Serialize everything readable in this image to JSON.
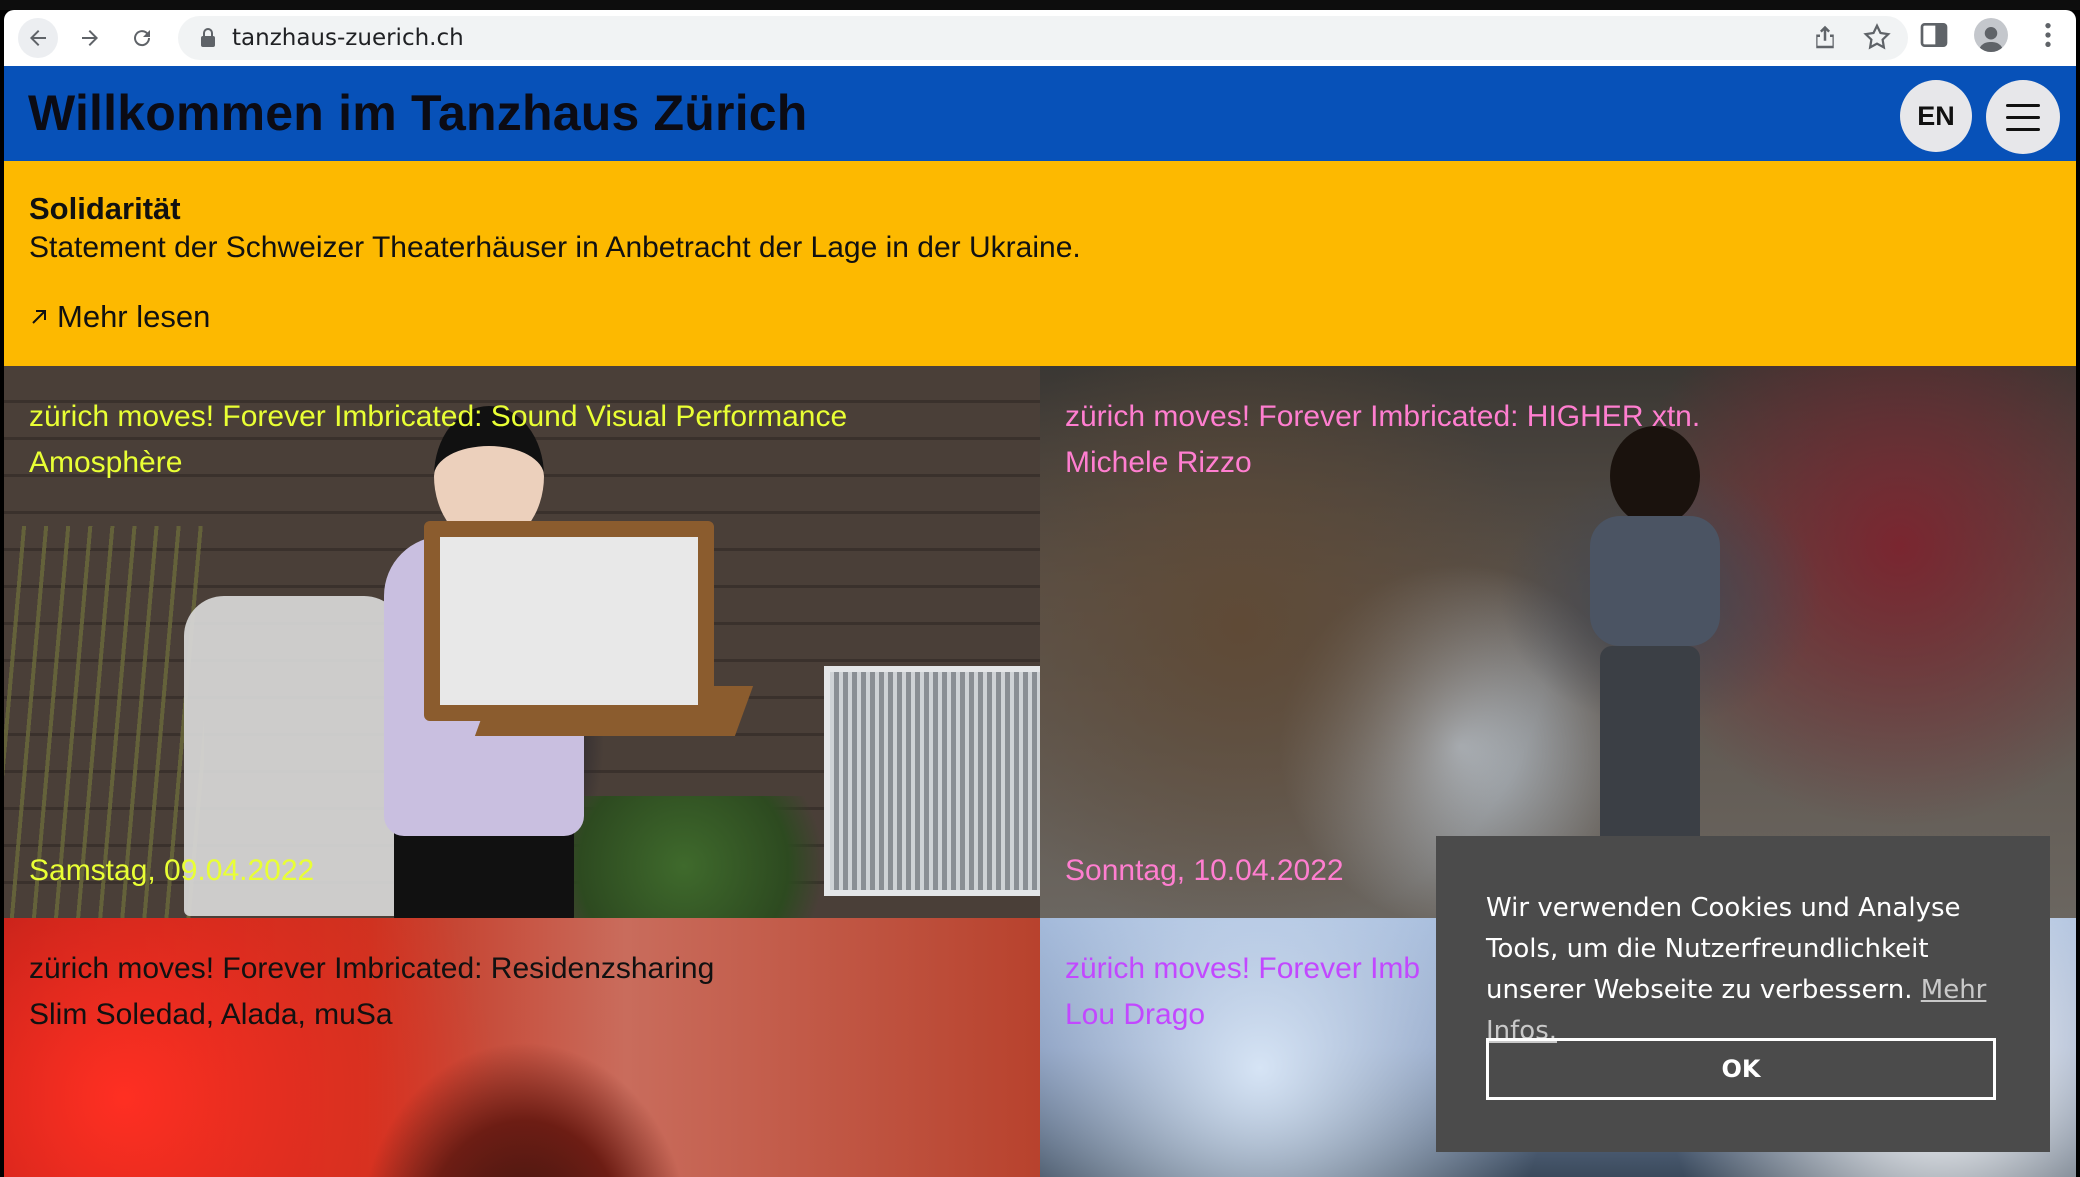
{
  "browser": {
    "url": "tanzhaus-zuerich.ch"
  },
  "header": {
    "title": "Willkommen im Tanzhaus Zürich",
    "lang_button": "EN"
  },
  "banner": {
    "title": "Solidarität",
    "text": "Statement der Schweizer Theaterhäuser in Anbetracht der Lage in der Ukraine.",
    "link": "Mehr lesen"
  },
  "events": [
    {
      "title": "zürich moves! Forever Imbricated: Sound Visual Performance",
      "artist": "Amosphère",
      "date": "Samstag, 09.04.2022"
    },
    {
      "title": "zürich moves! Forever Imbricated: HIGHER xtn.",
      "artist": "Michele Rizzo",
      "date": "Sonntag, 10.04.2022"
    },
    {
      "title": "zürich moves! Forever Imbricated: Residenzsharing",
      "artist": "Slim Soledad, Alada, muSa",
      "date": ""
    },
    {
      "title": "zürich moves! Forever Imb",
      "artist": "Lou Drago",
      "date": ""
    }
  ],
  "cookie": {
    "text": "Wir verwenden Cookies und Analyse Tools, um die Nutzerfreundlichkeit unserer Webseite zu verbessern.",
    "link": "Mehr Infos.",
    "ok": "OK"
  }
}
